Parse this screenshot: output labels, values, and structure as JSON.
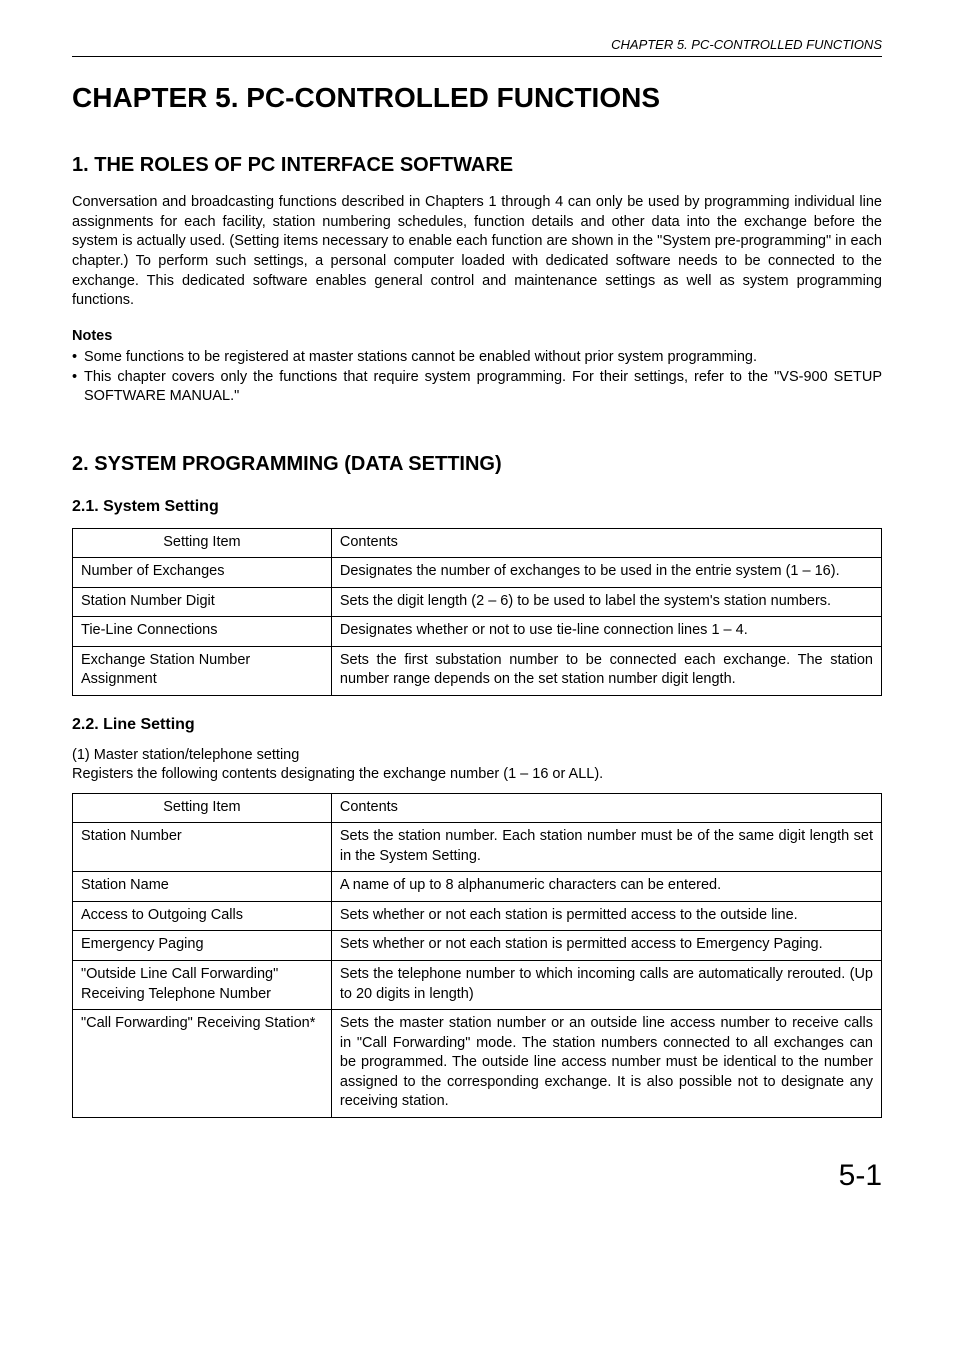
{
  "header": "CHAPTER 5.  PC-CONTROLLED FUNCTIONS",
  "chapter_title": "CHAPTER 5.  PC-CONTROLLED FUNCTIONS",
  "section1": {
    "title": "1. THE ROLES OF PC INTERFACE SOFTWARE",
    "body": "Conversation and broadcasting functions described in Chapters 1 through 4 can only be used by programming individual line assignments for each facility, station numbering schedules, function details and other data into the exchange before the system is actually used. (Setting items necessary to enable each function are shown in the \"System pre-programming\" in each chapter.) To perform such settings, a personal computer loaded with dedicated software needs to be connected to the exchange. This dedicated software enables general control and maintenance settings as well as system programming functions.",
    "notes_label": "Notes",
    "notes": [
      "Some functions to be registered at master stations cannot be enabled without prior system programming.",
      "This chapter covers only the functions that require system programming. For their settings, refer to the \"VS-900 SETUP SOFTWARE MANUAL.\""
    ]
  },
  "section2": {
    "title": "2. SYSTEM PROGRAMMING (DATA SETTING)",
    "sub21": {
      "title": "2.1. System Setting",
      "header_item": "Setting Item",
      "header_contents": "Contents",
      "rows": [
        {
          "item": "Number of Exchanges",
          "contents": "Designates the number of exchanges to be used in the entrie system (1 – 16)."
        },
        {
          "item": "Station Number Digit",
          "contents": "Sets the digit length (2 – 6) to be used to label the system's station numbers."
        },
        {
          "item": "Tie-Line Connections",
          "contents": "Designates whether or not to use tie-line connection lines 1 – 4."
        },
        {
          "item": "Exchange Station Number Assignment",
          "contents": "Sets the first substation number to be connected each exchange. The station number range depends on the set station number digit length."
        }
      ]
    },
    "sub22": {
      "title": "2.2. Line Setting",
      "intro1": "(1) Master station/telephone setting",
      "intro2": "Registers the following contents designating the exchange number (1 – 16 or ALL).",
      "header_item": "Setting Item",
      "header_contents": "Contents",
      "rows": [
        {
          "item": "Station Number",
          "contents": "Sets the station number. Each station number must be of the same digit length set in the System Setting."
        },
        {
          "item": "Station Name",
          "contents": "A name of up to 8 alphanumeric characters can be entered."
        },
        {
          "item": "Access to Outgoing Calls",
          "contents": "Sets whether or not each station is permitted access to the outside line."
        },
        {
          "item": "Emergency Paging",
          "contents": "Sets whether or not each station is permitted access to Emergency Paging."
        },
        {
          "item": "\"Outside Line Call Forwarding\" Receiving Telephone Number",
          "contents": "Sets the telephone number to which incoming calls are automatically rerouted. (Up to 20 digits in length)"
        },
        {
          "item": "\"Call Forwarding\" Receiving Station*",
          "contents": "Sets the master station number or an outside line access number to receive calls in \"Call Forwarding\" mode. The station numbers connected to all exchanges can be programmed. The outside line access number must be identical to the number assigned to the corresponding exchange. It is also possible not to designate any receiving station."
        }
      ]
    }
  },
  "page_number": "5-1"
}
